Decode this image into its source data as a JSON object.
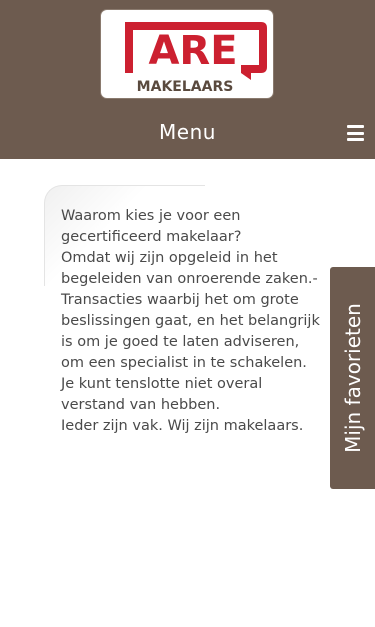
{
  "logo": {
    "mark_text": "ARE",
    "word_text": "MAKELAARS",
    "colors": {
      "red": "#cc2030",
      "dark": "#5a4a3e"
    }
  },
  "nav": {
    "menu_label": "Menu",
    "menu_icon": "hamburger-icon"
  },
  "article": {
    "lines": [
      "Waarom kies je voor een gecertificeerd makelaar?",
      "Omdat wij zijn opgeleid in het begeleiden van onroerende zaken.- Transacties waarbij het om grote beslissingen gaat, en het belangrijk is om je goed te laten adviseren, om een specialist in te schakelen.",
      "Je kunt tenslotte niet overal verstand van hebben.",
      "Ieder zijn vak. Wij zijn makelaars."
    ]
  },
  "favorites": {
    "label": "Mijn favorieten"
  },
  "colors": {
    "header_bg": "#6d5b4f",
    "text": "#4a4a4a"
  }
}
